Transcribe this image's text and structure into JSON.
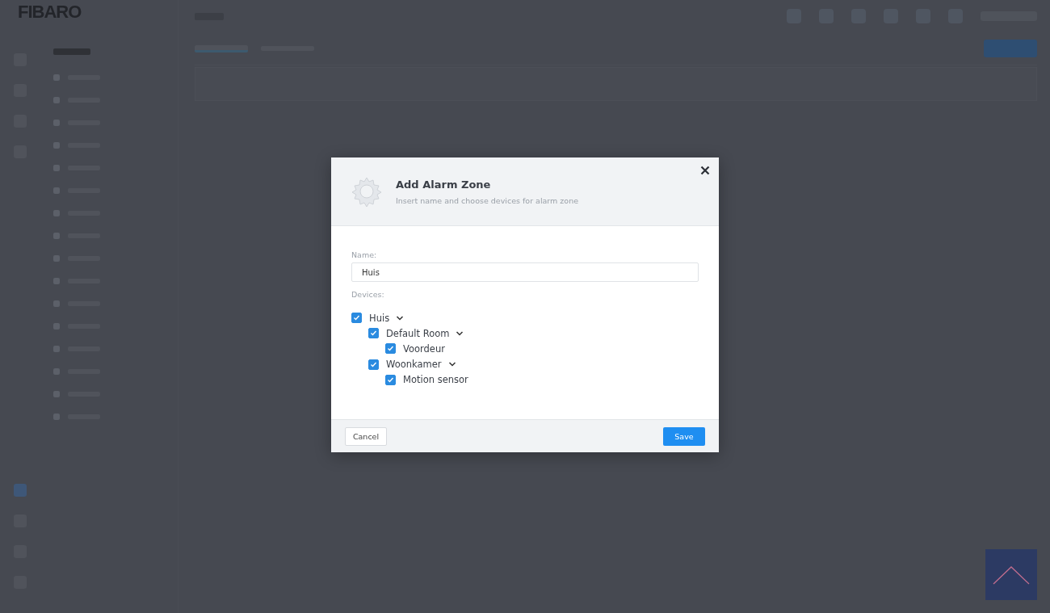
{
  "logo": "FIBARO",
  "dialog": {
    "title": "Add Alarm Zone",
    "subtitle": "Insert name and choose devices for alarm zone",
    "name_label": "Name:",
    "name_value": "Huis",
    "devices_label": "Devices:",
    "devices": [
      {
        "label": "Huis",
        "checked": true,
        "expanded": true,
        "children": [
          {
            "label": "Default Room",
            "checked": true,
            "expanded": true,
            "children": [
              {
                "label": "Voordeur",
                "checked": true
              }
            ]
          },
          {
            "label": "Woonkamer",
            "checked": true,
            "expanded": true,
            "children": [
              {
                "label": "Motion sensor",
                "checked": true
              }
            ]
          }
        ]
      }
    ],
    "cancel": "Cancel",
    "save": "Save"
  }
}
